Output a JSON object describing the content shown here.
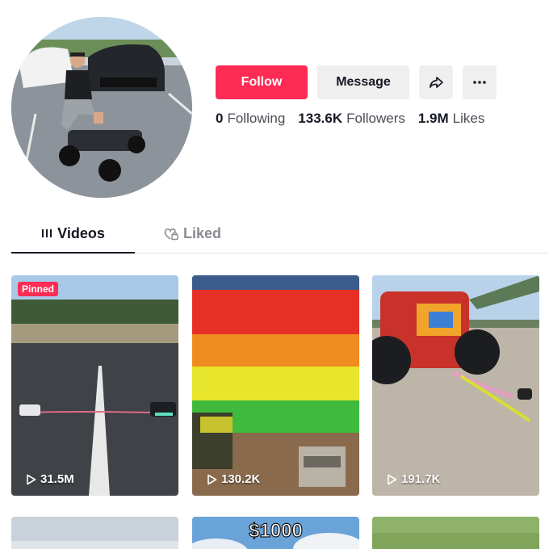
{
  "profile": {
    "follow_label": "Follow",
    "message_label": "Message",
    "share_icon": "share-icon",
    "more_icon": "more-icon",
    "stats": {
      "following_count": "0",
      "following_label": "Following",
      "followers_count": "133.6K",
      "followers_label": "Followers",
      "likes_count": "1.9M",
      "likes_label": "Likes"
    }
  },
  "tabs": [
    {
      "label": "Videos",
      "icon": "grid-icon",
      "active": true
    },
    {
      "label": "Liked",
      "icon": "heart-lock-icon",
      "active": false
    }
  ],
  "videos": [
    {
      "badge": "Pinned",
      "views": "31.5M"
    },
    {
      "views": "130.2K"
    },
    {
      "views": "191.7K"
    },
    {},
    {
      "overlay_text": "$1000"
    },
    {}
  ],
  "colors": {
    "accent": "#fe2c55",
    "button_bg": "#efeff0",
    "text": "#161823",
    "muted": "#8a8b91"
  }
}
